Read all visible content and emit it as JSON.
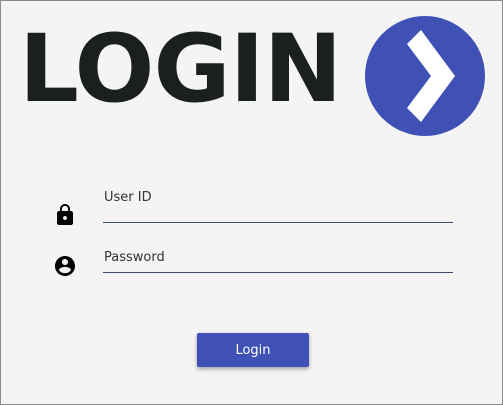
{
  "logo": {
    "text": "LOGIN",
    "circle_color": "#3f51b5",
    "icon": "chevron-right-icon"
  },
  "form": {
    "user_id": {
      "label": "User ID",
      "value": "",
      "icon": "lock-icon"
    },
    "password": {
      "label": "Password",
      "value": "",
      "icon": "account-circle-icon"
    },
    "submit_label": "Login"
  },
  "colors": {
    "accent": "#3f51b5",
    "text_dark": "#1c1f20",
    "background": "#f4f4f4"
  }
}
